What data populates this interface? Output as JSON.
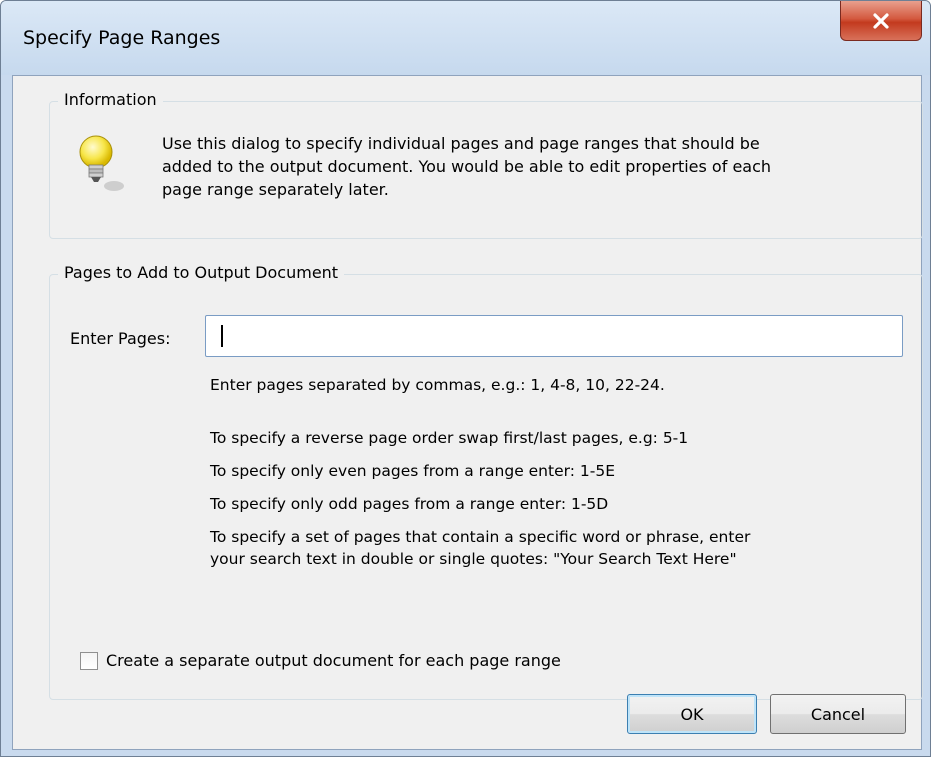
{
  "window": {
    "title": "Specify Page Ranges",
    "close_icon": "close-icon"
  },
  "info": {
    "legend": "Information",
    "icon": "lightbulb-icon",
    "text_lines": [
      "Use this dialog to specify individual pages and page ranges that should be",
      "added to the output document. You would be able to edit properties of each",
      "page range separately later."
    ]
  },
  "pages": {
    "legend": "Pages to Add to Output Document",
    "enter_label": "Enter Pages:",
    "input_value": "",
    "hints": [
      "Enter pages separated by commas, e.g.: 1, 4-8, 10, 22-24.",
      "To specify a reverse page order swap first/last pages, e.g: 5-1",
      "To specify only even pages from a range enter: 1-5E",
      "To specify only odd pages from a range enter: 1-5D",
      "To specify a set of pages that contain a specific word or phrase, enter",
      "your search text in double or single quotes: \"Your Search Text Here\""
    ],
    "checkbox_label": "Create a separate output document for each page range",
    "checkbox_checked": false
  },
  "buttons": {
    "ok": "OK",
    "cancel": "Cancel"
  }
}
